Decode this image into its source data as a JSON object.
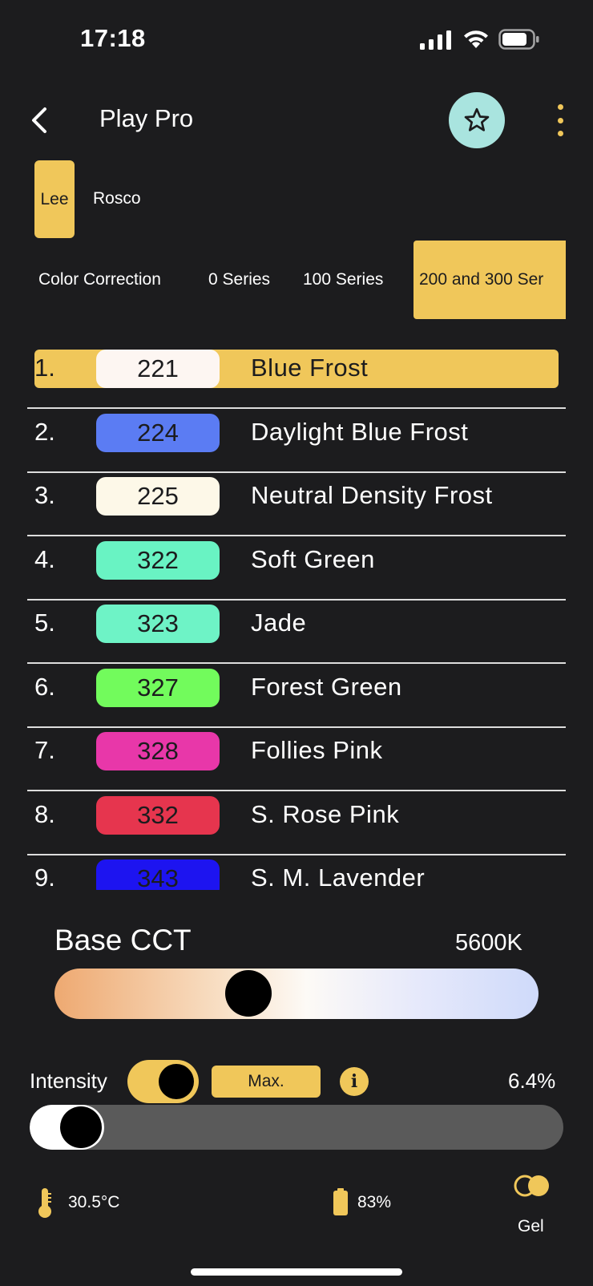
{
  "status_bar": {
    "time": "17:18"
  },
  "header": {
    "title": "Play Pro"
  },
  "brands": {
    "items": [
      "Lee",
      "Rosco"
    ],
    "selected": "Lee"
  },
  "series": {
    "tabs": [
      "Color Correction",
      "0 Series",
      "100 Series",
      "200 and 300 Ser"
    ],
    "selected": "200 and 300 Ser"
  },
  "gels": [
    {
      "num": "1.",
      "code": "221",
      "name": "Blue Frost",
      "color": "#fdf6f2",
      "selected": true
    },
    {
      "num": "2.",
      "code": "224",
      "name": "Daylight Blue Frost",
      "color": "#5b7cf3"
    },
    {
      "num": "3.",
      "code": "225",
      "name": "Neutral Density Frost",
      "color": "#fdf8e8"
    },
    {
      "num": "4.",
      "code": "322",
      "name": "Soft Green",
      "color": "#69f3c3"
    },
    {
      "num": "5.",
      "code": "323",
      "name": "Jade",
      "color": "#6ef3c6"
    },
    {
      "num": "6.",
      "code": "327",
      "name": "Forest Green",
      "color": "#72fb5c"
    },
    {
      "num": "7.",
      "code": "328",
      "name": "Follies Pink",
      "color": "#e837a9"
    },
    {
      "num": "8.",
      "code": "332",
      "name": "S. Rose Pink",
      "color": "#e6354e"
    },
    {
      "num": "9.",
      "code": "343",
      "name": "S. M. Lavender",
      "color": "#1d14f0"
    }
  ],
  "base_cct": {
    "label": "Base CCT",
    "value": "5600K",
    "position_fraction": 0.4
  },
  "intensity": {
    "label": "Intensity",
    "max_label": "Max.",
    "value": "6.4%",
    "level_fraction": 0.064
  },
  "footer": {
    "temperature": "30.5°C",
    "battery": "83%",
    "gel_label": "Gel"
  },
  "colors": {
    "accent": "#f0c75a",
    "background": "#1c1c1e",
    "favorite": "#a9e4df"
  }
}
